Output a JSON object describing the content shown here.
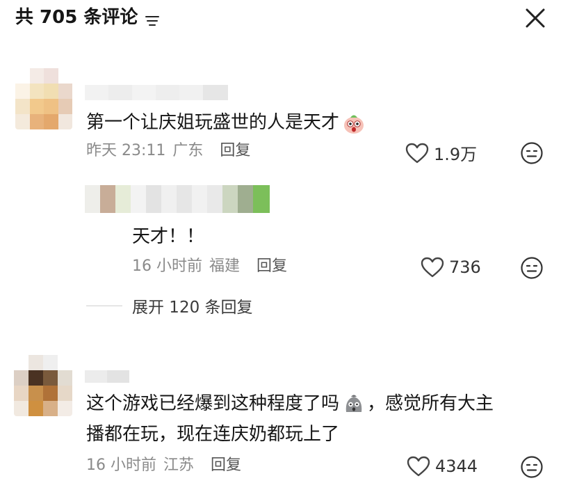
{
  "header": {
    "title": "共 705 条评论",
    "filter_icon": "filter-lines-icon",
    "close_icon": "close-x-icon"
  },
  "comments": [
    {
      "text": "第一个让庆姐玩盛世的人是天才",
      "trailing_emoji": "shocked-face-emoji",
      "time": "昨天 23:11",
      "location": "广东",
      "reply_label": "回复",
      "likes": "1.9万",
      "replies": [
        {
          "text": "天才！！",
          "time": "16 小时前",
          "location": "福建",
          "reply_label": "回复",
          "likes": "736"
        }
      ],
      "expand_label": "展开 120 条回复"
    },
    {
      "text_line1_before": "这个游戏已经爆到这种程度了吗",
      "inline_emoji": "shocked-gray-face-emoji",
      "text_line1_after": "，感觉所有大主",
      "text_line2": "播都在玩，现在连庆奶都玩上了",
      "time": "16 小时前",
      "location": "江苏",
      "reply_label": "回复",
      "likes": "4344"
    }
  ],
  "colors": {
    "text_primary": "#161616",
    "text_meta": "#8a8a8a",
    "background": "#ffffff"
  }
}
